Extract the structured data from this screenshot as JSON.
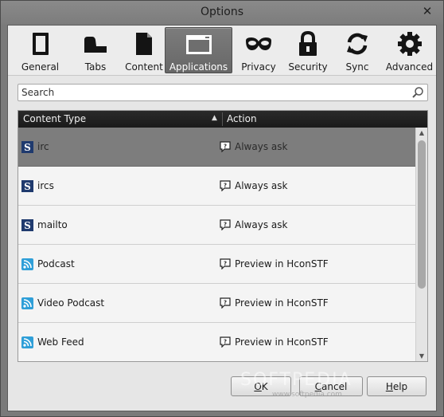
{
  "window": {
    "title": "Options",
    "close_glyph": "✕"
  },
  "toolbar": {
    "items": [
      {
        "label": "General",
        "icon": "general-icon",
        "active": false
      },
      {
        "label": "Tabs",
        "icon": "tabs-icon",
        "active": false
      },
      {
        "label": "Content",
        "icon": "content-icon",
        "active": false
      },
      {
        "label": "Applications",
        "icon": "applications-icon",
        "active": true
      },
      {
        "label": "Privacy",
        "icon": "privacy-mask-icon",
        "active": false
      },
      {
        "label": "Security",
        "icon": "lock-icon",
        "active": false
      },
      {
        "label": "Sync",
        "icon": "sync-icon",
        "active": false
      },
      {
        "label": "Advanced",
        "icon": "gear-icon",
        "active": false
      }
    ]
  },
  "search": {
    "placeholder": "Search",
    "value": ""
  },
  "table": {
    "columns": {
      "content_type": "Content Type",
      "action": "Action",
      "sort_glyph": "▲"
    },
    "rows": [
      {
        "type": "irc",
        "icon": "s-app-icon",
        "action": "Always ask",
        "selected": true
      },
      {
        "type": "ircs",
        "icon": "s-app-icon",
        "action": "Always ask",
        "selected": false
      },
      {
        "type": "mailto",
        "icon": "s-app-icon",
        "action": "Always ask",
        "selected": false
      },
      {
        "type": "Podcast",
        "icon": "feed-icon",
        "action": "Preview in HconSTF",
        "selected": false
      },
      {
        "type": "Video Podcast",
        "icon": "feed-icon",
        "action": "Preview in HconSTF",
        "selected": false
      },
      {
        "type": "Web Feed",
        "icon": "feed-icon",
        "action": "Preview in HconSTF",
        "selected": false
      }
    ],
    "scroll": {
      "up": "▲",
      "down": "▼"
    }
  },
  "buttons": {
    "ok": {
      "pre": "",
      "accel": "O",
      "post": "K"
    },
    "cancel": {
      "pre": "",
      "accel": "C",
      "post": "ancel"
    },
    "help": {
      "pre": "",
      "accel": "H",
      "post": "elp"
    }
  },
  "watermark": {
    "text": "SOFTPEDIA",
    "sub": "www.softpedia.com"
  },
  "colors": {
    "accent_dark": "#1a1a1a",
    "selected_row": "#7d7d7d",
    "feed": "#2f9fd8",
    "s_icon": "#1f3a6e"
  }
}
